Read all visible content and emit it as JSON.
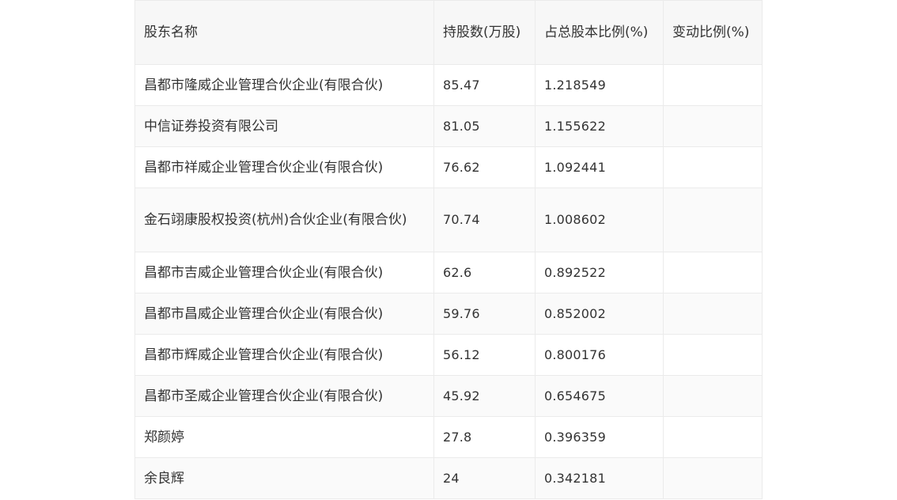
{
  "table": {
    "headers": [
      "股东名称",
      "持股数(万股)",
      "占总股本比例(%)",
      "变动比例(%)"
    ],
    "rows": [
      [
        "昌都市隆威企业管理合伙企业(有限合伙)",
        "85.47",
        "1.218549",
        ""
      ],
      [
        "中信证券投资有限公司",
        "81.05",
        "1.155622",
        ""
      ],
      [
        "昌都市祥威企业管理合伙企业(有限合伙)",
        "76.62",
        "1.092441",
        ""
      ],
      [
        "金石翊康股权投资(杭州)合伙企业(有限合伙)",
        "70.74",
        "1.008602",
        ""
      ],
      [
        "昌都市吉威企业管理合伙企业(有限合伙)",
        "62.6",
        "0.892522",
        ""
      ],
      [
        "昌都市昌威企业管理合伙企业(有限合伙)",
        "59.76",
        "0.852002",
        ""
      ],
      [
        "昌都市辉威企业管理合伙企业(有限合伙)",
        "56.12",
        "0.800176",
        ""
      ],
      [
        "昌都市圣威企业管理合伙企业(有限合伙)",
        "45.92",
        "0.654675",
        ""
      ],
      [
        "郑颜婷",
        "27.8",
        "0.396359",
        ""
      ],
      [
        "余良辉",
        "24",
        "0.342181",
        ""
      ]
    ]
  }
}
